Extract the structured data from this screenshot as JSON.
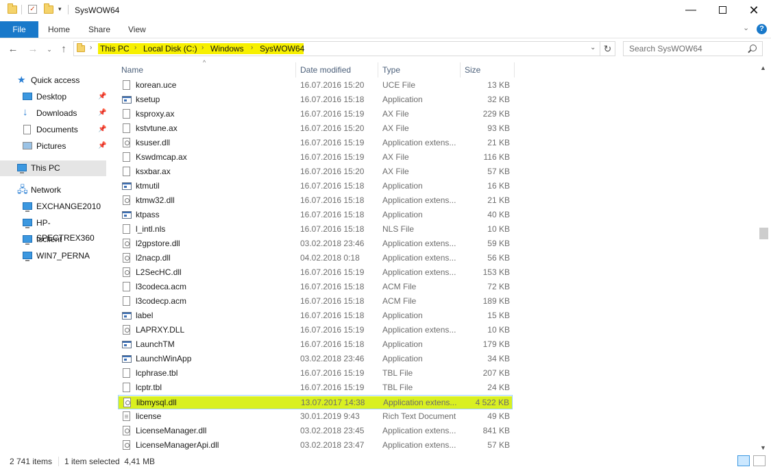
{
  "window": {
    "title": "SysWOW64"
  },
  "ribbon": {
    "tabs": [
      "File",
      "Home",
      "Share",
      "View"
    ]
  },
  "address": {
    "crumbs": [
      "This PC",
      "Local Disk (C:)",
      "Windows",
      "SysWOW64"
    ]
  },
  "search": {
    "placeholder": "Search SysWOW64"
  },
  "sidebar": {
    "quick_access": "Quick access",
    "quick_items": [
      "Desktop",
      "Downloads",
      "Documents",
      "Pictures"
    ],
    "this_pc": "This PC",
    "network": "Network",
    "network_items": [
      "EXCHANGE2010",
      "HP-SPECTREX360",
      "tsclient",
      "WIN7_PERNA"
    ]
  },
  "columns": {
    "name": "Name",
    "date": "Date modified",
    "type": "Type",
    "size": "Size"
  },
  "files": [
    {
      "name": "korean.uce",
      "date": "16.07.2016 15:20",
      "type": "UCE File",
      "size": "13 KB",
      "icon": "file"
    },
    {
      "name": "ksetup",
      "date": "16.07.2016 15:18",
      "type": "Application",
      "size": "32 KB",
      "icon": "app"
    },
    {
      "name": "ksproxy.ax",
      "date": "16.07.2016 15:19",
      "type": "AX File",
      "size": "229 KB",
      "icon": "file"
    },
    {
      "name": "kstvtune.ax",
      "date": "16.07.2016 15:20",
      "type": "AX File",
      "size": "93 KB",
      "icon": "file"
    },
    {
      "name": "ksuser.dll",
      "date": "16.07.2016 15:19",
      "type": "Application extens...",
      "size": "21 KB",
      "icon": "dll"
    },
    {
      "name": "Kswdmcap.ax",
      "date": "16.07.2016 15:19",
      "type": "AX File",
      "size": "116 KB",
      "icon": "file"
    },
    {
      "name": "ksxbar.ax",
      "date": "16.07.2016 15:20",
      "type": "AX File",
      "size": "57 KB",
      "icon": "file"
    },
    {
      "name": "ktmutil",
      "date": "16.07.2016 15:18",
      "type": "Application",
      "size": "16 KB",
      "icon": "app"
    },
    {
      "name": "ktmw32.dll",
      "date": "16.07.2016 15:18",
      "type": "Application extens...",
      "size": "21 KB",
      "icon": "dll"
    },
    {
      "name": "ktpass",
      "date": "16.07.2016 15:18",
      "type": "Application",
      "size": "40 KB",
      "icon": "app"
    },
    {
      "name": "l_intl.nls",
      "date": "16.07.2016 15:18",
      "type": "NLS File",
      "size": "10 KB",
      "icon": "file"
    },
    {
      "name": "l2gpstore.dll",
      "date": "03.02.2018 23:46",
      "type": "Application extens...",
      "size": "59 KB",
      "icon": "dll"
    },
    {
      "name": "l2nacp.dll",
      "date": "04.02.2018 0:18",
      "type": "Application extens...",
      "size": "56 KB",
      "icon": "dll"
    },
    {
      "name": "L2SecHC.dll",
      "date": "16.07.2016 15:19",
      "type": "Application extens...",
      "size": "153 KB",
      "icon": "dll"
    },
    {
      "name": "l3codeca.acm",
      "date": "16.07.2016 15:18",
      "type": "ACM File",
      "size": "72 KB",
      "icon": "file"
    },
    {
      "name": "l3codecp.acm",
      "date": "16.07.2016 15:18",
      "type": "ACM File",
      "size": "189 KB",
      "icon": "file"
    },
    {
      "name": "label",
      "date": "16.07.2016 15:18",
      "type": "Application",
      "size": "15 KB",
      "icon": "app"
    },
    {
      "name": "LAPRXY.DLL",
      "date": "16.07.2016 15:19",
      "type": "Application extens...",
      "size": "10 KB",
      "icon": "dll"
    },
    {
      "name": "LaunchTM",
      "date": "16.07.2016 15:18",
      "type": "Application",
      "size": "179 KB",
      "icon": "app"
    },
    {
      "name": "LaunchWinApp",
      "date": "03.02.2018 23:46",
      "type": "Application",
      "size": "34 KB",
      "icon": "app"
    },
    {
      "name": "lcphrase.tbl",
      "date": "16.07.2016 15:19",
      "type": "TBL File",
      "size": "207 KB",
      "icon": "file"
    },
    {
      "name": "lcptr.tbl",
      "date": "16.07.2016 15:19",
      "type": "TBL File",
      "size": "24 KB",
      "icon": "file"
    },
    {
      "name": "libmysql.dll",
      "date": "13.07.2017 14:38",
      "type": "Application extens...",
      "size": "4 522 KB",
      "icon": "dll",
      "selected": true
    },
    {
      "name": "license",
      "date": "30.01.2019 9:43",
      "type": "Rich Text Document",
      "size": "49 KB",
      "icon": "doc"
    },
    {
      "name": "LicenseManager.dll",
      "date": "03.02.2018 23:45",
      "type": "Application extens...",
      "size": "841 KB",
      "icon": "dll"
    },
    {
      "name": "LicenseManagerApi.dll",
      "date": "03.02.2018 23:47",
      "type": "Application extens...",
      "size": "57 KB",
      "icon": "dll"
    }
  ],
  "status": {
    "count": "2 741 items",
    "selection": "1 item selected  4,41 MB"
  },
  "colors": {
    "accent": "#1979ca",
    "highlight_yellow": "#f7f000",
    "highlight_green": "#d9f020"
  }
}
